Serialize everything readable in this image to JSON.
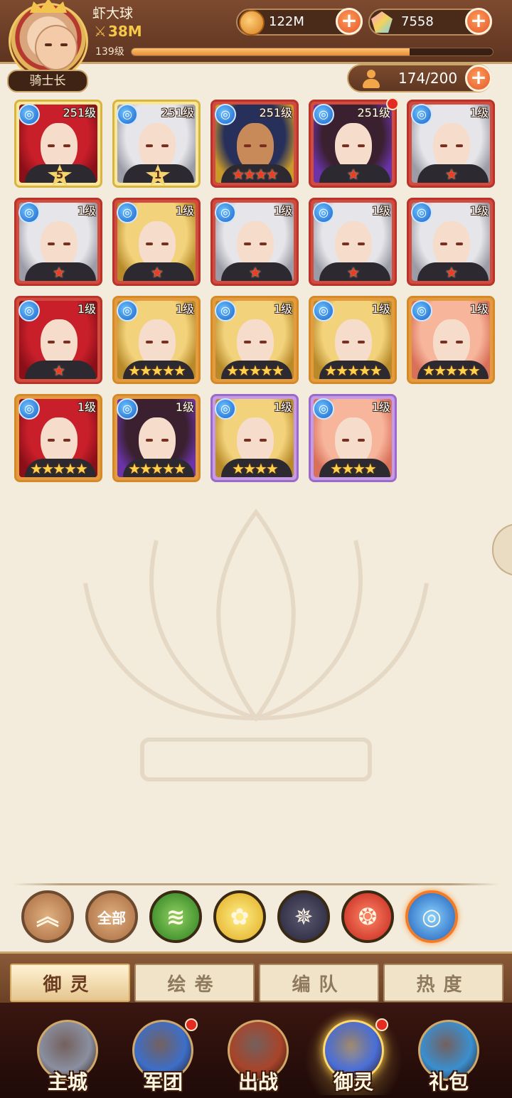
{
  "header": {
    "player_name": "虾大球",
    "power": "38M",
    "level": "139级",
    "exp_fraction": 0.77,
    "rank_title": "骑士长",
    "coins": "122M",
    "gems": "7558"
  },
  "roster": {
    "count": "174/200"
  },
  "heroes": [
    {
      "level": "251级",
      "quality": "gold",
      "awaken": "5",
      "stars": "",
      "hair": "red",
      "dot": false
    },
    {
      "level": "251级",
      "quality": "gold",
      "awaken": "1",
      "stars": "",
      "hair": "silver",
      "dot": false
    },
    {
      "level": "251级",
      "quality": "red",
      "awaken": "",
      "stars": "★★★★",
      "star_color": "red",
      "hair": "gold-crown",
      "dot": false
    },
    {
      "level": "251级",
      "quality": "red",
      "awaken": "",
      "stars": "★",
      "star_color": "red",
      "hair": "black",
      "dot": true
    },
    {
      "level": "1级",
      "quality": "red",
      "awaken": "",
      "stars": "★",
      "star_color": "red",
      "hair": "silver",
      "dot": false
    },
    {
      "level": "1级",
      "quality": "red",
      "awaken": "",
      "stars": "★",
      "star_color": "red",
      "hair": "silver",
      "dot": false
    },
    {
      "level": "1级",
      "quality": "red",
      "awaken": "",
      "stars": "★",
      "star_color": "red",
      "hair": "blond",
      "dot": false
    },
    {
      "level": "1级",
      "quality": "red",
      "awaken": "",
      "stars": "★",
      "star_color": "red",
      "hair": "silver",
      "dot": false
    },
    {
      "level": "1级",
      "quality": "red",
      "awaken": "",
      "stars": "★",
      "star_color": "red",
      "hair": "silver",
      "dot": false
    },
    {
      "level": "1级",
      "quality": "red",
      "awaken": "",
      "stars": "★",
      "star_color": "red",
      "hair": "silver",
      "dot": false
    },
    {
      "level": "1级",
      "quality": "red",
      "awaken": "",
      "stars": "★",
      "star_color": "red",
      "hair": "red",
      "dot": false
    },
    {
      "level": "1级",
      "quality": "orange",
      "awaken": "",
      "stars": "★★★★★",
      "star_color": "gold",
      "hair": "blond",
      "dot": false
    },
    {
      "level": "1级",
      "quality": "orange",
      "awaken": "",
      "stars": "★★★★★",
      "star_color": "gold",
      "hair": "blond",
      "dot": false
    },
    {
      "level": "1级",
      "quality": "orange",
      "awaken": "",
      "stars": "★★★★★",
      "star_color": "gold",
      "hair": "blond",
      "dot": false
    },
    {
      "level": "1级",
      "quality": "orange",
      "awaken": "",
      "stars": "★★★★★",
      "star_color": "gold",
      "hair": "pink",
      "dot": false
    },
    {
      "level": "1级",
      "quality": "orange",
      "awaken": "",
      "stars": "★★★★★",
      "star_color": "gold",
      "hair": "red",
      "dot": false
    },
    {
      "level": "1级",
      "quality": "orange",
      "awaken": "",
      "stars": "★★★★★",
      "star_color": "gold",
      "hair": "black",
      "dot": false
    },
    {
      "level": "1级",
      "quality": "purple",
      "awaken": "",
      "stars": "★★★★",
      "star_color": "gold",
      "hair": "blond",
      "dot": false
    },
    {
      "level": "1级",
      "quality": "purple",
      "awaken": "",
      "stars": "★★★★",
      "star_color": "gold",
      "hair": "pink",
      "dot": false
    }
  ],
  "filters": [
    {
      "name": "collapse-filter",
      "label": "",
      "glyph": "︽",
      "cls": "f-up"
    },
    {
      "name": "filter-all",
      "label": "全部",
      "glyph": "",
      "cls": "f-all"
    },
    {
      "name": "filter-wind-icon",
      "label": "",
      "glyph": "≋",
      "cls": "f-green"
    },
    {
      "name": "filter-light-icon",
      "label": "",
      "glyph": "✿",
      "cls": "f-gold"
    },
    {
      "name": "filter-dark-icon",
      "label": "",
      "glyph": "✵",
      "cls": "f-dark"
    },
    {
      "name": "filter-fire-icon",
      "label": "",
      "glyph": "❂",
      "cls": "f-fire"
    },
    {
      "name": "filter-water-icon",
      "label": "",
      "glyph": "◎",
      "cls": "f-water"
    }
  ],
  "tabs": [
    {
      "label": "御灵",
      "active": true
    },
    {
      "label": "绘卷",
      "active": false
    },
    {
      "label": "编队",
      "active": false
    },
    {
      "label": "热度",
      "active": false
    }
  ],
  "nav": [
    {
      "label": "主城",
      "active": false,
      "dot": false,
      "color": "#8a8fa0"
    },
    {
      "label": "军团",
      "active": false,
      "dot": true,
      "color": "#3d6ec9"
    },
    {
      "label": "出战",
      "active": false,
      "dot": false,
      "color": "#a8442a"
    },
    {
      "label": "御灵",
      "active": true,
      "dot": true,
      "color": "#4a6fd8"
    },
    {
      "label": "礼包",
      "active": false,
      "dot": false,
      "color": "#3a8fd0"
    }
  ],
  "colors": {
    "topbar": "#6b3d26",
    "background": "#f3ebdc",
    "accent_orange": "#e4572a",
    "active_tab_text": "#6a3b1f"
  }
}
